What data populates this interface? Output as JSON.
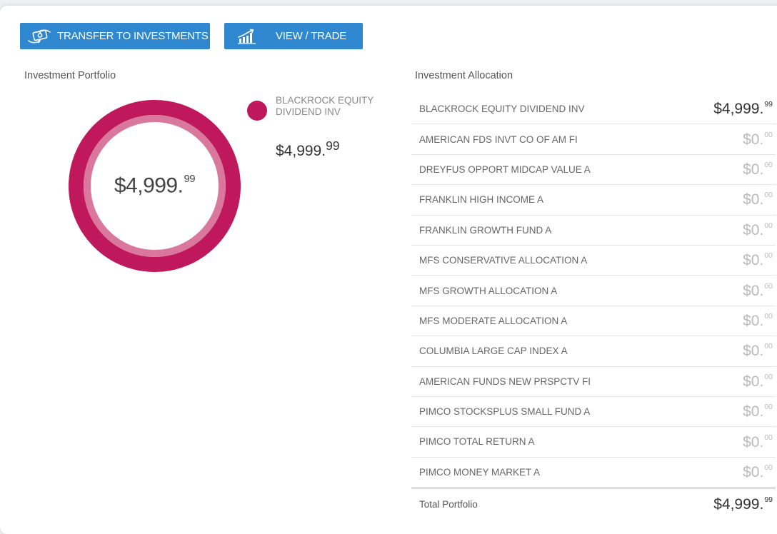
{
  "toolbar": {
    "transfer_label": "TRANSFER TO INVESTMENTS",
    "transfer_icon": "money-transfer-icon",
    "view_trade_label": "VIEW / TRADE",
    "view_trade_icon": "growth-chart-icon"
  },
  "colors": {
    "button_blue": "#2e87cf",
    "portfolio_magenta": "#c0185c",
    "portfolio_magenta_light": "#d9779d"
  },
  "portfolio": {
    "title": "Investment Portfolio",
    "total_main": "$4,999.",
    "total_cents": "99",
    "legend": [
      {
        "name": "BLACKROCK EQUITY DIVIDEND INV",
        "amount_main": "$4,999.",
        "amount_cents": "99",
        "share": 1.0
      }
    ]
  },
  "allocation": {
    "title": "Investment Allocation",
    "rows": [
      {
        "name": "BLACKROCK EQUITY DIVIDEND INV",
        "amount_main": "$4,999.",
        "amount_cents": "99"
      },
      {
        "name": "AMERICAN FDS INVT CO OF AM FI",
        "amount_main": "$0.",
        "amount_cents": "00"
      },
      {
        "name": "DREYFUS OPPORT MIDCAP VALUE A",
        "amount_main": "$0.",
        "amount_cents": "00"
      },
      {
        "name": "FRANKLIN HIGH INCOME A",
        "amount_main": "$0.",
        "amount_cents": "00"
      },
      {
        "name": "FRANKLIN GROWTH FUND A",
        "amount_main": "$0.",
        "amount_cents": "00"
      },
      {
        "name": "MFS CONSERVATIVE ALLOCATION A",
        "amount_main": "$0.",
        "amount_cents": "00"
      },
      {
        "name": "MFS GROWTH ALLOCATION A",
        "amount_main": "$0.",
        "amount_cents": "00"
      },
      {
        "name": "MFS MODERATE ALLOCATION A",
        "amount_main": "$0.",
        "amount_cents": "00"
      },
      {
        "name": "COLUMBIA LARGE CAP INDEX A",
        "amount_main": "$0.",
        "amount_cents": "00"
      },
      {
        "name": "AMERICAN FUNDS NEW PRSPCTV FI",
        "amount_main": "$0.",
        "amount_cents": "00"
      },
      {
        "name": "PIMCO STOCKSPLUS SMALL FUND A",
        "amount_main": "$0.",
        "amount_cents": "00"
      },
      {
        "name": "PIMCO TOTAL RETURN A",
        "amount_main": "$0.",
        "amount_cents": "00"
      },
      {
        "name": "PIMCO MONEY MARKET A",
        "amount_main": "$0.",
        "amount_cents": "00"
      }
    ],
    "total_label": "Total Portfolio",
    "total_main": "$4,999.",
    "total_cents": "99"
  }
}
